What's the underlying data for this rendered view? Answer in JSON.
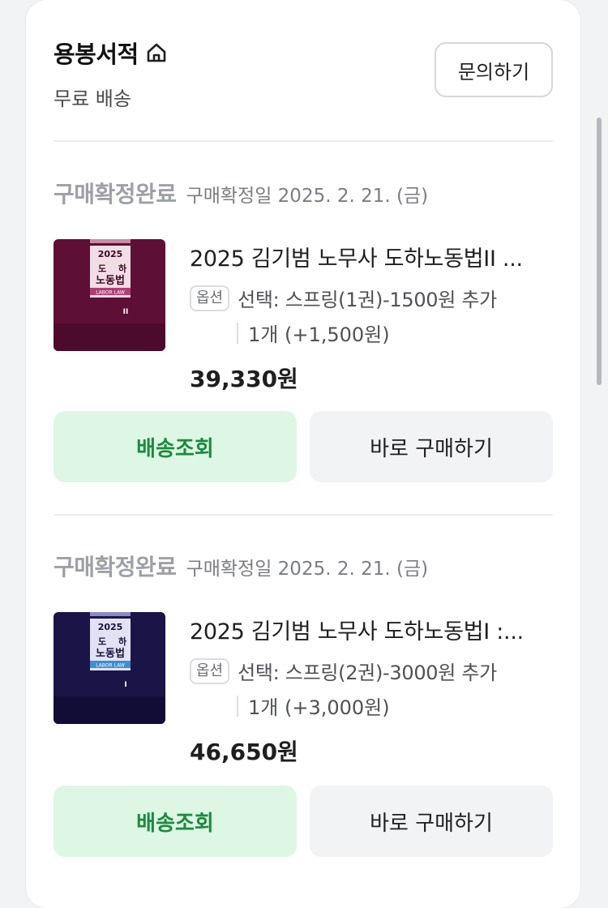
{
  "shop": {
    "name": "용봉서적",
    "shipping": "무료 배송",
    "inquiry_label": "문의하기",
    "home_icon": "home-icon"
  },
  "orders": [
    {
      "status": "구매확정완료",
      "confirm_date": "구매확정일 2025. 2. 21. (금)",
      "title": "2025 김기범 노무사 도하노동법II ...",
      "option_tag": "옵션",
      "option": "선택: 스프링(1권)-1500원 추가",
      "quantity": "1개 (+1,500원)",
      "price": "39,330원",
      "track_label": "배송조회",
      "buy_label": "바로 구매하기",
      "cover": {
        "year": "2025",
        "line1a": "도",
        "line1b": "하",
        "line2": "노동법",
        "band": "LABOR LAW",
        "vol": "II",
        "color": "#5e0f36"
      }
    },
    {
      "status": "구매확정완료",
      "confirm_date": "구매확정일 2025. 2. 21. (금)",
      "title": "2025 김기범 노무사 도하노동법I :...",
      "option_tag": "옵션",
      "option": "선택: 스프링(2권)-3000원 추가",
      "quantity": "1개 (+3,000원)",
      "price": "46,650원",
      "track_label": "배송조회",
      "buy_label": "바로 구매하기",
      "cover": {
        "year": "2025",
        "line1a": "도",
        "line1b": "하",
        "line2": "노동법",
        "band": "LABOR LAW",
        "vol": "I",
        "color": "#1b1446"
      }
    }
  ]
}
